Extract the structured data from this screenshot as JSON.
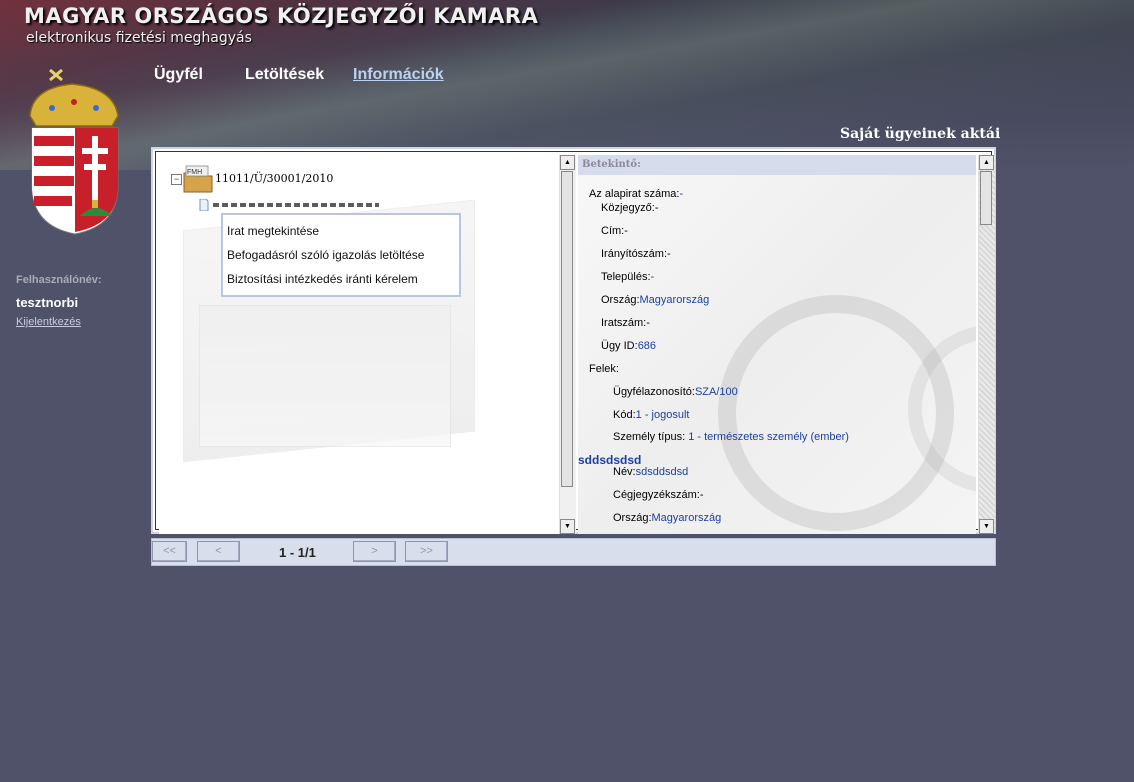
{
  "header": {
    "title": "MAGYAR ORSZÁGOS KÖZJEGYZŐI KAMARA",
    "subtitle": "elektronikus fizetési meghagyás"
  },
  "nav": {
    "items": [
      {
        "label": "Ügyfél"
      },
      {
        "label": "Letöltések"
      },
      {
        "label": "Információk"
      }
    ]
  },
  "user": {
    "label": "Felhasználónév:",
    "name": "tesztnorbi",
    "logout": "Kijelentkezés"
  },
  "section_title": "Saját ügyeinek aktái",
  "tree": {
    "folder_badge": "FMH",
    "root_label": "11011/Ü/30001/2010"
  },
  "context_menu": {
    "items": [
      "Irat megtekintése",
      "Befogadásról szóló igazolás letöltése",
      "Biztosítási intézkedés iránti kérelem"
    ]
  },
  "details": {
    "header": "Betekintő:",
    "alapirat_label": "Az alapirat száma:",
    "alapirat_value": "-",
    "kozjegyzo_label": "Közjegyző:",
    "kozjegyzo_value": "-",
    "cim_label": "Cím:",
    "cim_value": "-",
    "iranyitoszam_label": "Irányítószám:",
    "iranyitoszam_value": "-",
    "telepules_label": "Település:",
    "telepules_value": "-",
    "orszag_label": "Ország:",
    "orszag_value": "Magyarország",
    "iratszam_label": "Iratszám:",
    "iratszam_value": "-",
    "ugyid_label": "Ügy ID:",
    "ugyid_value": "686",
    "felek_label": "Felek:",
    "ugyfelazonosito_label": "Ügyfélazonosító:",
    "ugyfelazonosito_value": "SZA/100",
    "kod_label": "Kód:",
    "kod_value": "1 - jogosult",
    "szemely_label": "Személy típus:",
    "szemely_value": "1 - természetes személy (ember)",
    "company": "sddsdsdsd",
    "nev_label": "Név:",
    "nev_value": "sdsddsdsd",
    "cegjegyzek_label": "Cégjegyzékszám:",
    "cegjegyzek_value": "-",
    "orszag2_label": "Ország:",
    "orszag2_value": "Magyarország"
  },
  "pager": {
    "first": "<<",
    "prev": "<",
    "indicator": "1 - 1/1",
    "next": ">",
    "last": ">>"
  },
  "colors": {
    "background": "#4f5268",
    "link_value": "#1d3fa0",
    "active_nav": "#bcd0ef"
  }
}
